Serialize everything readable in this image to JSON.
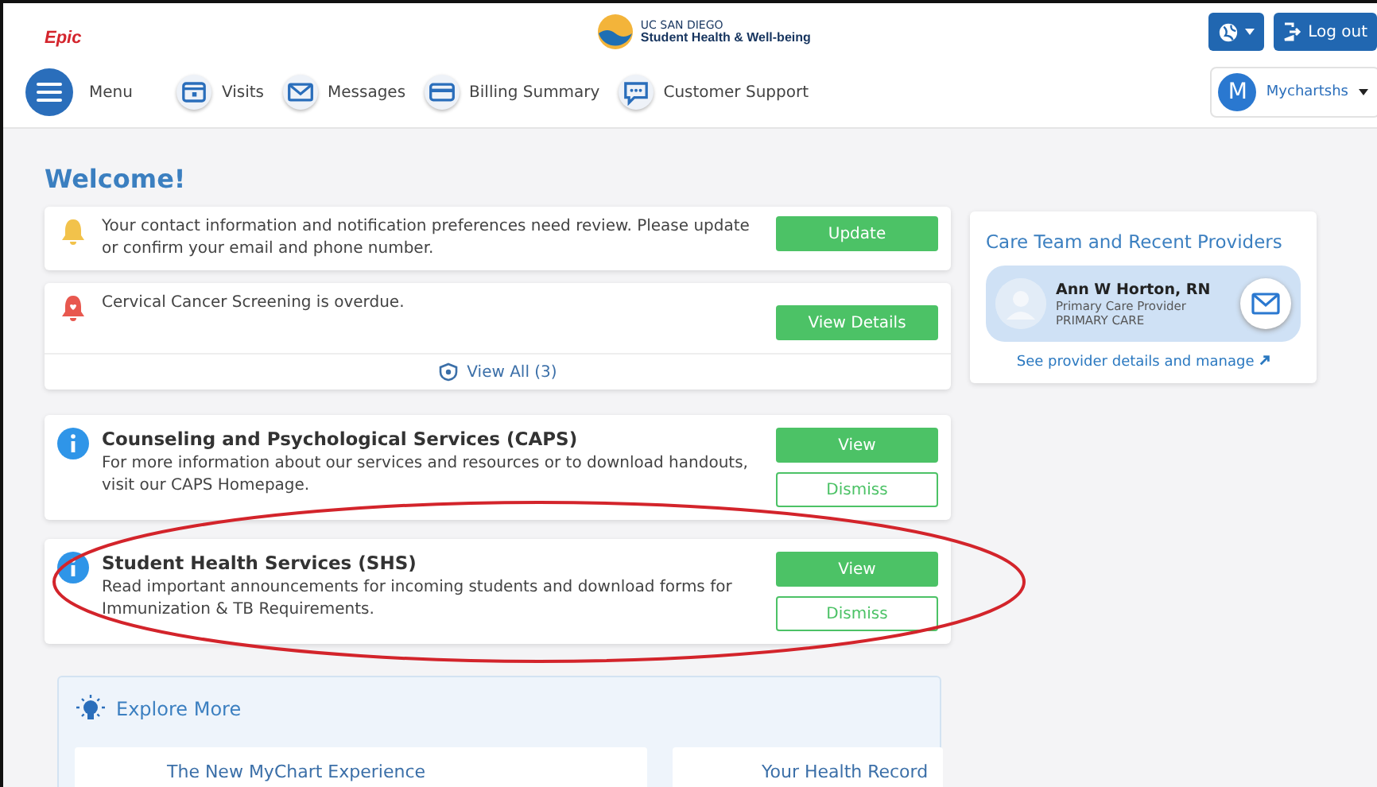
{
  "header": {
    "brand": "Epic",
    "logo_line1": "UC SAN DIEGO",
    "logo_line2": "Student Health & Well-being",
    "logout": "Log out",
    "menu": "Menu",
    "nav": [
      {
        "kind": "visits",
        "label": "Visits"
      },
      {
        "kind": "messages",
        "label": "Messages"
      },
      {
        "kind": "billing",
        "label": "Billing Summary"
      },
      {
        "kind": "support",
        "label": "Customer Support"
      }
    ],
    "user": {
      "initial": "M",
      "name": "Mychartshs"
    }
  },
  "welcome": "Welcome!",
  "alerts": [
    {
      "kind": "warning",
      "text": "Your contact information and notification preferences need review. Please update or confirm your email and phone number.",
      "button": "Update"
    },
    {
      "kind": "overdue",
      "text": "Cervical Cancer Screening is overdue.",
      "button": "View Details"
    }
  ],
  "view_all": "View All (3)",
  "messages": [
    {
      "title": "Counseling and Psychological Services (CAPS)",
      "text": "For more information about our services and resources or to download handouts, visit our CAPS Homepage.",
      "view": "View",
      "dismiss": "Dismiss"
    },
    {
      "title": "Student Health Services (SHS)",
      "text": "Read important announcements for incoming students and download forms for Immunization & TB Requirements.",
      "view": "View",
      "dismiss": "Dismiss"
    }
  ],
  "explore": {
    "title": "Explore More",
    "cards": [
      {
        "title": "The New MyChart Experience"
      },
      {
        "title": "Your Health Record"
      }
    ]
  },
  "care_team": {
    "title": "Care Team and Recent Providers",
    "provider": {
      "name": "Ann W Horton, RN",
      "role": "Primary Care Provider",
      "department": "PRIMARY CARE"
    },
    "link": "See provider details and manage"
  }
}
